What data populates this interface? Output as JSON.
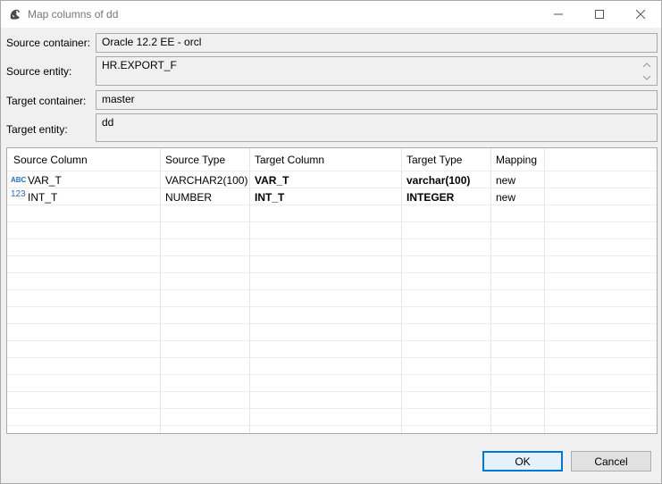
{
  "window": {
    "title": "Map columns of dd"
  },
  "form": {
    "source_container_label": "Source container:",
    "source_container_value": "Oracle 12.2 EE - orcl",
    "source_entity_label": "Source entity:",
    "source_entity_value": "HR.EXPORT_F",
    "target_container_label": "Target container:",
    "target_container_value": "master",
    "target_entity_label": "Target entity:",
    "target_entity_value": "dd"
  },
  "table": {
    "headers": [
      "Source Column",
      "Source Type",
      "Target Column",
      "Target Type",
      "Mapping"
    ],
    "rows": [
      {
        "icon_text": "ABC",
        "icon": "string-type-icon",
        "source_column": "VAR_T",
        "source_type": "VARCHAR2(100)",
        "target_column": "VAR_T",
        "target_type": "varchar(100)",
        "mapping": "new"
      },
      {
        "icon_text": "123",
        "icon": "number-type-icon",
        "source_column": "INT_T",
        "source_type": "NUMBER",
        "target_column": "INT_T",
        "target_type": "INTEGER",
        "mapping": "new"
      }
    ]
  },
  "buttons": {
    "ok_label": "OK",
    "cancel_label": "Cancel"
  },
  "colors": {
    "accent": "#0078d7",
    "type_icon": "#2a6fbf"
  }
}
